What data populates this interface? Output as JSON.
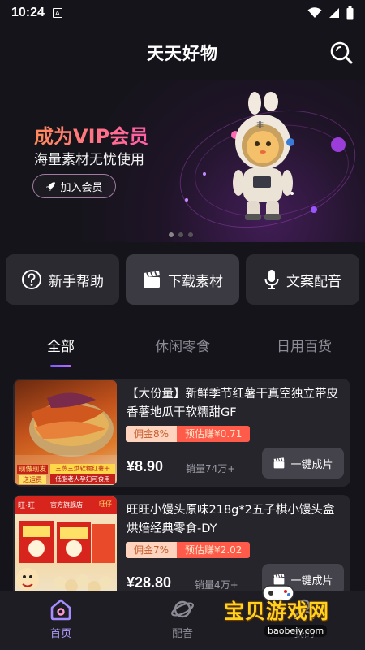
{
  "status_bar": {
    "time": "10:24",
    "notification_letter": "A"
  },
  "header": {
    "title": "天天好物"
  },
  "banner": {
    "title": "成为VIP会员",
    "subtitle": "海量素材无忧使用",
    "join_label": "加入会员",
    "mascot_badge": "非"
  },
  "quick_actions": [
    {
      "label": "新手帮助",
      "icon": "help-circle-icon"
    },
    {
      "label": "下载素材",
      "icon": "clapperboard-icon"
    },
    {
      "label": "文案配音",
      "icon": "microphone-icon"
    }
  ],
  "tabs": [
    {
      "label": "全部",
      "active": true
    },
    {
      "label": "休闲零食",
      "active": false
    },
    {
      "label": "日用百货",
      "active": false
    }
  ],
  "products": [
    {
      "title": "【大份量】新鲜季节红薯干真空独立带皮香薯地瓜干软糯甜GF",
      "commission": "佣金8%",
      "estimate": "预估赚¥0.71",
      "price": "¥8.90",
      "sales": "销量74万+",
      "button": "一键成片",
      "thumb_texts": [
        "现做现发",
        "送运费",
        "三蒸三烘软糯红薯干",
        "低脂老人孕妇可食用"
      ]
    },
    {
      "title": "旺旺小馒头原味218g*2五子棋小馒头盒烘焙经典零食-DY",
      "commission": "佣金7%",
      "estimate": "预估赚¥2.02",
      "price": "¥28.80",
      "sales": "销量4万+",
      "button": "一键成片",
      "thumb_texts": [
        "旺·旺",
        "官方旗舰店",
        "旺仔"
      ]
    }
  ],
  "bottom_nav": [
    {
      "label": "首页",
      "icon": "home-icon",
      "active": true
    },
    {
      "label": "配音",
      "icon": "planet-icon",
      "active": false
    },
    {
      "label": "我的",
      "icon": "user-icon",
      "active": false
    }
  ],
  "watermark": {
    "text": "宝贝游戏网",
    "url": "baobeiy.com"
  },
  "colors": {
    "accent": "#b49dff",
    "background": "#15141a",
    "card": "#26252c",
    "estimate_tag": "#ff5b4b",
    "commission_tag": "#ffd4bf"
  }
}
